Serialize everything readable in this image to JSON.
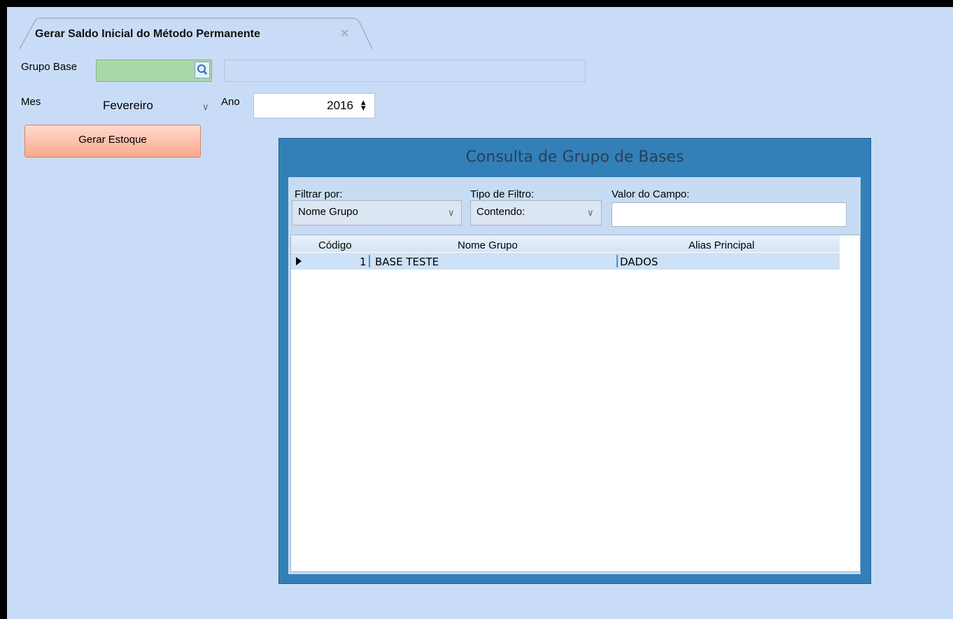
{
  "tab": {
    "title": "Gerar Saldo Inicial do Método Permanente",
    "close": "✕"
  },
  "form": {
    "grupo_base_label": "Grupo Base",
    "grupo_base_code": "",
    "grupo_base_desc": "",
    "mes_label": "Mes",
    "mes_value": "Fevereiro",
    "ano_label": "Ano",
    "ano_value": "2016",
    "gerar_button": "Gerar Estoque"
  },
  "dialog": {
    "title": "Consulta de Grupo de Bases",
    "filtrar_label": "Filtrar por:",
    "filtrar_value": "Nome Grupo",
    "tipo_label": "Tipo de Filtro:",
    "tipo_value": "Contendo:",
    "valor_label": "Valor do Campo:",
    "valor_value": "",
    "grid": {
      "columns": [
        "Código",
        "Nome Grupo",
        "Alias Principal"
      ],
      "rows": [
        {
          "codigo": "1",
          "nome": "BASE TESTE",
          "alias": "DADOS"
        }
      ]
    }
  },
  "colors": {
    "background": "#c9dcf7",
    "grupo_code_fill": "#a9d8a9",
    "button_fill": "#fba98e",
    "dialog_frame": "#3380b8",
    "selected_row": "#cde1f7"
  },
  "icons": [
    "search-icon",
    "chevron-down-icon",
    "spin-arrows-icon",
    "close-icon",
    "row-pointer-icon"
  ]
}
